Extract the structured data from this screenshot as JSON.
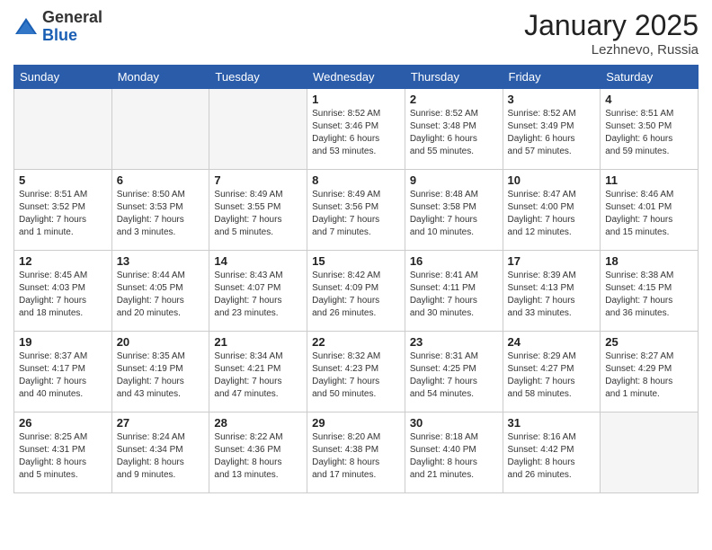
{
  "logo": {
    "general": "General",
    "blue": "Blue"
  },
  "header": {
    "month_year": "January 2025",
    "location": "Lezhnevo, Russia"
  },
  "weekdays": [
    "Sunday",
    "Monday",
    "Tuesday",
    "Wednesday",
    "Thursday",
    "Friday",
    "Saturday"
  ],
  "weeks": [
    [
      {
        "day": "",
        "info": ""
      },
      {
        "day": "",
        "info": ""
      },
      {
        "day": "",
        "info": ""
      },
      {
        "day": "1",
        "info": "Sunrise: 8:52 AM\nSunset: 3:46 PM\nDaylight: 6 hours\nand 53 minutes."
      },
      {
        "day": "2",
        "info": "Sunrise: 8:52 AM\nSunset: 3:48 PM\nDaylight: 6 hours\nand 55 minutes."
      },
      {
        "day": "3",
        "info": "Sunrise: 8:52 AM\nSunset: 3:49 PM\nDaylight: 6 hours\nand 57 minutes."
      },
      {
        "day": "4",
        "info": "Sunrise: 8:51 AM\nSunset: 3:50 PM\nDaylight: 6 hours\nand 59 minutes."
      }
    ],
    [
      {
        "day": "5",
        "info": "Sunrise: 8:51 AM\nSunset: 3:52 PM\nDaylight: 7 hours\nand 1 minute."
      },
      {
        "day": "6",
        "info": "Sunrise: 8:50 AM\nSunset: 3:53 PM\nDaylight: 7 hours\nand 3 minutes."
      },
      {
        "day": "7",
        "info": "Sunrise: 8:49 AM\nSunset: 3:55 PM\nDaylight: 7 hours\nand 5 minutes."
      },
      {
        "day": "8",
        "info": "Sunrise: 8:49 AM\nSunset: 3:56 PM\nDaylight: 7 hours\nand 7 minutes."
      },
      {
        "day": "9",
        "info": "Sunrise: 8:48 AM\nSunset: 3:58 PM\nDaylight: 7 hours\nand 10 minutes."
      },
      {
        "day": "10",
        "info": "Sunrise: 8:47 AM\nSunset: 4:00 PM\nDaylight: 7 hours\nand 12 minutes."
      },
      {
        "day": "11",
        "info": "Sunrise: 8:46 AM\nSunset: 4:01 PM\nDaylight: 7 hours\nand 15 minutes."
      }
    ],
    [
      {
        "day": "12",
        "info": "Sunrise: 8:45 AM\nSunset: 4:03 PM\nDaylight: 7 hours\nand 18 minutes."
      },
      {
        "day": "13",
        "info": "Sunrise: 8:44 AM\nSunset: 4:05 PM\nDaylight: 7 hours\nand 20 minutes."
      },
      {
        "day": "14",
        "info": "Sunrise: 8:43 AM\nSunset: 4:07 PM\nDaylight: 7 hours\nand 23 minutes."
      },
      {
        "day": "15",
        "info": "Sunrise: 8:42 AM\nSunset: 4:09 PM\nDaylight: 7 hours\nand 26 minutes."
      },
      {
        "day": "16",
        "info": "Sunrise: 8:41 AM\nSunset: 4:11 PM\nDaylight: 7 hours\nand 30 minutes."
      },
      {
        "day": "17",
        "info": "Sunrise: 8:39 AM\nSunset: 4:13 PM\nDaylight: 7 hours\nand 33 minutes."
      },
      {
        "day": "18",
        "info": "Sunrise: 8:38 AM\nSunset: 4:15 PM\nDaylight: 7 hours\nand 36 minutes."
      }
    ],
    [
      {
        "day": "19",
        "info": "Sunrise: 8:37 AM\nSunset: 4:17 PM\nDaylight: 7 hours\nand 40 minutes."
      },
      {
        "day": "20",
        "info": "Sunrise: 8:35 AM\nSunset: 4:19 PM\nDaylight: 7 hours\nand 43 minutes."
      },
      {
        "day": "21",
        "info": "Sunrise: 8:34 AM\nSunset: 4:21 PM\nDaylight: 7 hours\nand 47 minutes."
      },
      {
        "day": "22",
        "info": "Sunrise: 8:32 AM\nSunset: 4:23 PM\nDaylight: 7 hours\nand 50 minutes."
      },
      {
        "day": "23",
        "info": "Sunrise: 8:31 AM\nSunset: 4:25 PM\nDaylight: 7 hours\nand 54 minutes."
      },
      {
        "day": "24",
        "info": "Sunrise: 8:29 AM\nSunset: 4:27 PM\nDaylight: 7 hours\nand 58 minutes."
      },
      {
        "day": "25",
        "info": "Sunrise: 8:27 AM\nSunset: 4:29 PM\nDaylight: 8 hours\nand 1 minute."
      }
    ],
    [
      {
        "day": "26",
        "info": "Sunrise: 8:25 AM\nSunset: 4:31 PM\nDaylight: 8 hours\nand 5 minutes."
      },
      {
        "day": "27",
        "info": "Sunrise: 8:24 AM\nSunset: 4:34 PM\nDaylight: 8 hours\nand 9 minutes."
      },
      {
        "day": "28",
        "info": "Sunrise: 8:22 AM\nSunset: 4:36 PM\nDaylight: 8 hours\nand 13 minutes."
      },
      {
        "day": "29",
        "info": "Sunrise: 8:20 AM\nSunset: 4:38 PM\nDaylight: 8 hours\nand 17 minutes."
      },
      {
        "day": "30",
        "info": "Sunrise: 8:18 AM\nSunset: 4:40 PM\nDaylight: 8 hours\nand 21 minutes."
      },
      {
        "day": "31",
        "info": "Sunrise: 8:16 AM\nSunset: 4:42 PM\nDaylight: 8 hours\nand 26 minutes."
      },
      {
        "day": "",
        "info": ""
      }
    ]
  ]
}
